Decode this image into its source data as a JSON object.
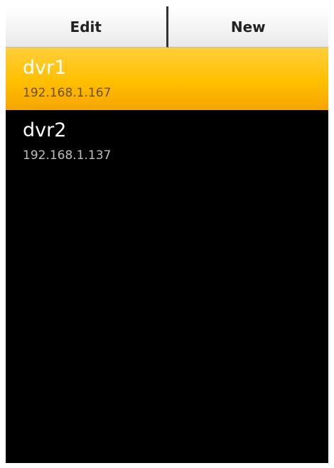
{
  "toolbar": {
    "edit_label": "Edit",
    "new_label": "New"
  },
  "devices": [
    {
      "name": "dvr1",
      "ip": "192.168.1.167",
      "selected": true
    },
    {
      "name": "dvr2",
      "ip": "192.168.1.137",
      "selected": false
    }
  ],
  "colors": {
    "background": "#000000",
    "selection": "#ffbf00",
    "toolbar_button": "#ffffff"
  }
}
